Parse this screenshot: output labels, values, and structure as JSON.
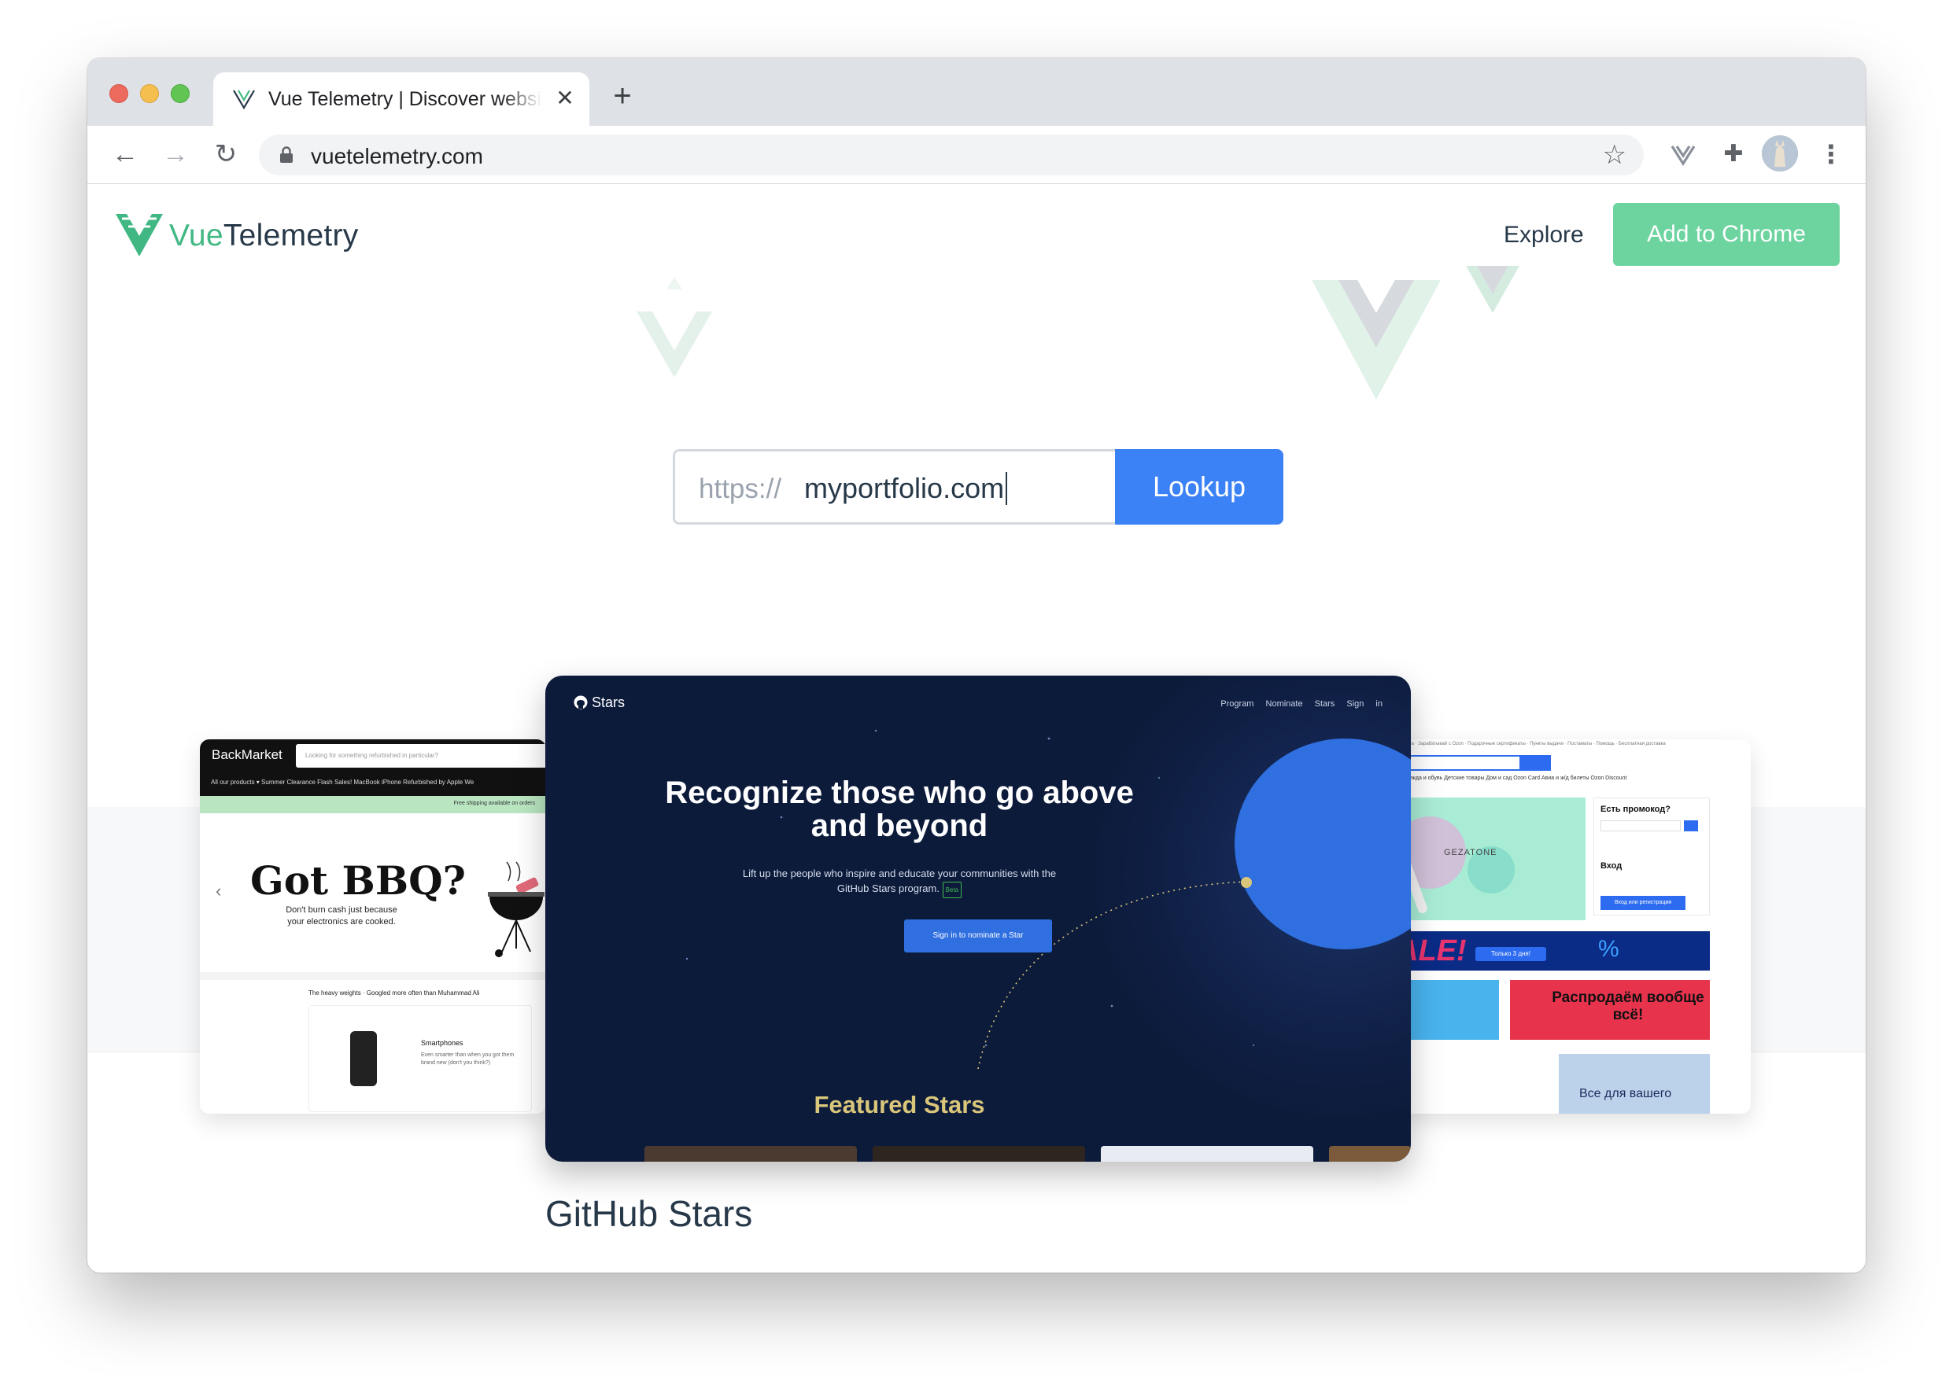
{
  "browser": {
    "tab_title": "Vue Telemetry | Discover websites built with Vue",
    "tab_close": "✕",
    "new_tab": "+",
    "url": "vuetelemetry.com",
    "nav_back": "←",
    "nav_forward": "→",
    "nav_reload": "↻",
    "bookmark_star": "☆",
    "extension_puzzle": "✚",
    "menu_dots": "⋮"
  },
  "header": {
    "logo_vue": "Vue",
    "logo_telemetry": "Telemetry",
    "explore": "Explore",
    "add_to_chrome": "Add to Chrome"
  },
  "search": {
    "prefix": "https://",
    "value": "myportfolio.com",
    "button": "Lookup"
  },
  "carousel": {
    "active_caption": "GitHub Stars",
    "backmarket": {
      "brand": "BackMarket",
      "search_placeholder": "Looking for something refurbished in particular?",
      "nav": "All our products ▾     Summer Clearance    Flash Sales!    MacBook    iPhone    Refurbished by Apple    We",
      "shipping": "Free shipping available on orders",
      "hero_title": "Got BBQ?",
      "hero_sub": "Don't burn cash just because your electronics are cooked.",
      "section": "The heavy weights · Googled more often than Muhammad Ali",
      "product_name": "Smartphones",
      "product_desc": "Even smarter than when you got them brand new (don't you think?)",
      "arrow": "‹"
    },
    "github_stars": {
      "logo": "Stars",
      "nav": "Program Nominate Stars Sign in",
      "title": "Recognize those who go above and beyond",
      "subtitle": "Lift up the people who inspire and educate your communities with the GitHub Stars program.",
      "beta": "Beta",
      "button": "Sign in to nominate a Star",
      "featured": "Featured Stars"
    },
    "ozon": {
      "top": "Наша · Зарабатывай с Ozon · Подарочные сертификаты · Пункты выдачи · Постаматы · Помощь · Бесплатная доставка",
      "cats": "Одежда и обувь   Детские товары   Дом и сад   Ozon Card   Авиа и ж/д билеты   Ozon Discount",
      "banner_brand": "GEZATONE",
      "promo_title": "Есть промокод?",
      "login_title": "Вход",
      "login_btn": "Вход или регистрация",
      "sale": "ALE!",
      "sale_pill": "Только 3 дня!",
      "sale_pct": "%",
      "tile_b": "Распродаём вообще всё!",
      "tile_c": "Все для вашего"
    }
  },
  "colors": {
    "vue_green": "#41b883",
    "vue_dark": "#273849",
    "add_to_chrome_bg": "#6dd4a0",
    "lookup_bg": "#3b82f6",
    "gh_bg": "#0d1b3b",
    "gh_planet": "#2f6fe0",
    "gh_featured": "#d9c67a"
  }
}
